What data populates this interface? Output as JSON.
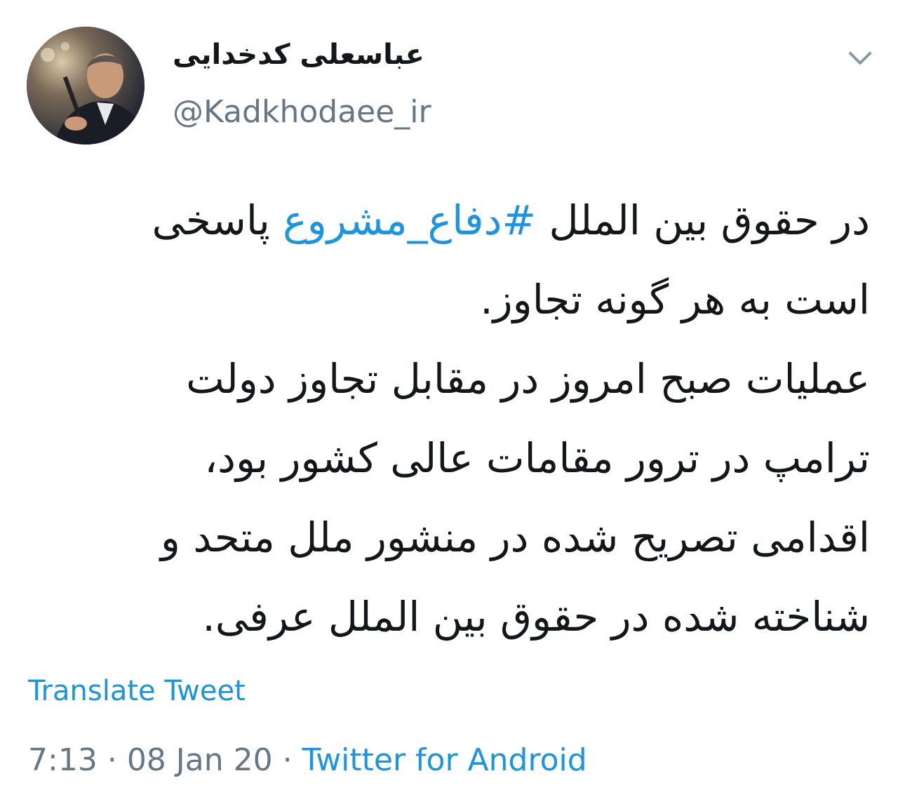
{
  "author": {
    "display_name": "عباسعلی کدخدایی",
    "handle": "@Kadkhodaee_ir"
  },
  "tweet": {
    "lines": [
      {
        "before": "در حقوق بین الملل ",
        "hashtag": "#دفاع_مشروع",
        "after": " پاسخی"
      },
      {
        "text": "است به هر گونه تجاوز."
      },
      {
        "text": " عملیات صبح امروز در مقابل تجاوز دولت"
      },
      {
        "text": "ترامپ در ترور مقامات عالی کشور بود،"
      },
      {
        "text": "اقدامی تصریح شده در منشور ملل متحد و"
      },
      {
        "text": "شناخته شده در حقوق بین الملل عرفی."
      }
    ]
  },
  "translate_label": "Translate Tweet",
  "meta": {
    "time": "7:13",
    "date": "08 Jan 20",
    "separator": "·",
    "source": "Twitter for Android"
  },
  "colors": {
    "link": "#1b95e0",
    "text": "#14171a",
    "muted": "#657786"
  },
  "icons": {
    "menu": "chevron-down-icon"
  }
}
